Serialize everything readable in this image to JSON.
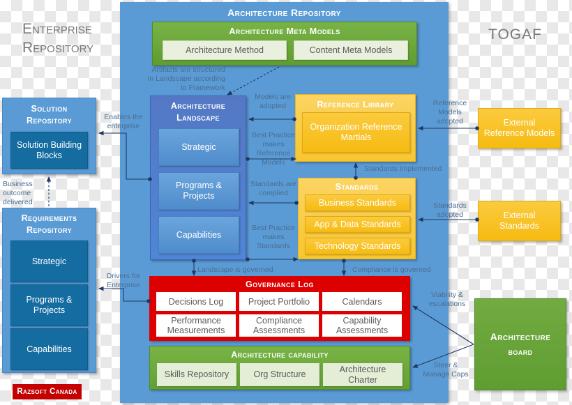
{
  "watermarks": {
    "left": "Enterprise\nRepository",
    "right": "TOGAF"
  },
  "architecture_repository": {
    "title": "Architecture Repository",
    "meta_models": {
      "title": "Architecture Meta Models",
      "items": [
        "Architecture Method",
        "Content Meta Models"
      ]
    },
    "landscape": {
      "title": "Architecture\nLandscape",
      "items": [
        "Strategic",
        "Programs &\nProjects",
        "Capabilities"
      ]
    },
    "reference_library": {
      "title": "Reference Library",
      "items": [
        "Organization Reference\nMartials"
      ]
    },
    "standards": {
      "title": "Standards",
      "items": [
        "Business Standards",
        "App & Data  Standards",
        "Technology Standards"
      ]
    },
    "governance_log": {
      "title": "Governance Log",
      "items": [
        "Decisions Log",
        "Project Portfolio",
        "Calendars",
        "Performance\nMeasurements",
        "Compliance\nAssessments",
        "Capability\nAssessments"
      ]
    },
    "architecture_capability": {
      "title": "Architecture capability",
      "items": [
        "Skills Repository",
        "Org Structure",
        "Architecture\nCharter"
      ]
    }
  },
  "solution_repository": {
    "title": "Solution\nRepository",
    "items": [
      "Solution Building\nBlocks"
    ]
  },
  "requirements_repository": {
    "title": "Requirements\nRepository",
    "items": [
      "Strategic",
      "Programs &\nProjects",
      "Capabilities"
    ]
  },
  "external": {
    "reference_models": "External\nReference Models",
    "standards": "External\nStandards"
  },
  "architecture_board": {
    "line1": "Architecture",
    "line2": "board"
  },
  "logo": {
    "text": "Razsoft Canada"
  },
  "connectors": [
    {
      "id": "artifacts-structured",
      "label": "Artifacts are structured\nin Landscape according\nto Framework"
    },
    {
      "id": "enables-enterprise",
      "label": "Enables the\nenterprise"
    },
    {
      "id": "business-outcome",
      "label": "Business\noutcome\ndelivered"
    },
    {
      "id": "models-adopted",
      "label": "Models are\nadopted"
    },
    {
      "id": "best-practice-reference",
      "label": "Best Practice\nmakes\nReference\nModels"
    },
    {
      "id": "standards-complied",
      "label": "Standards are\ncomplied"
    },
    {
      "id": "best-practice-standards",
      "label": "Best Practice\nmakes\nStandards"
    },
    {
      "id": "reference-models-adopted",
      "label": "Reference\nModels\nadopted"
    },
    {
      "id": "standards-implemented",
      "label": "Standards Implemented"
    },
    {
      "id": "standards-adopted",
      "label": "Standards\nadopted"
    },
    {
      "id": "landscape-governed",
      "label": "Landscape is governed"
    },
    {
      "id": "compliance-governed",
      "label": "Compliance is governed"
    },
    {
      "id": "drivers-enterprise",
      "label": "Drivers for\nEnterprise"
    },
    {
      "id": "viability-escalations",
      "label": "Viability &\nescalations"
    },
    {
      "id": "steer-manage",
      "label": "Steer &\nManage Caps"
    }
  ],
  "colors": {
    "repository_blue": "#5b9bd5",
    "landscape_blue": "#4f86d6",
    "chip_dark_blue": "#146ca0",
    "meta_green": "#5f9d31",
    "capability_green": "#63a033",
    "board_green": "#5f9d31",
    "standards_yellow": "#f8c62f",
    "governance_red": "#dc0000",
    "logo_red": "#c40000",
    "connector_navy": "#1f3864"
  }
}
